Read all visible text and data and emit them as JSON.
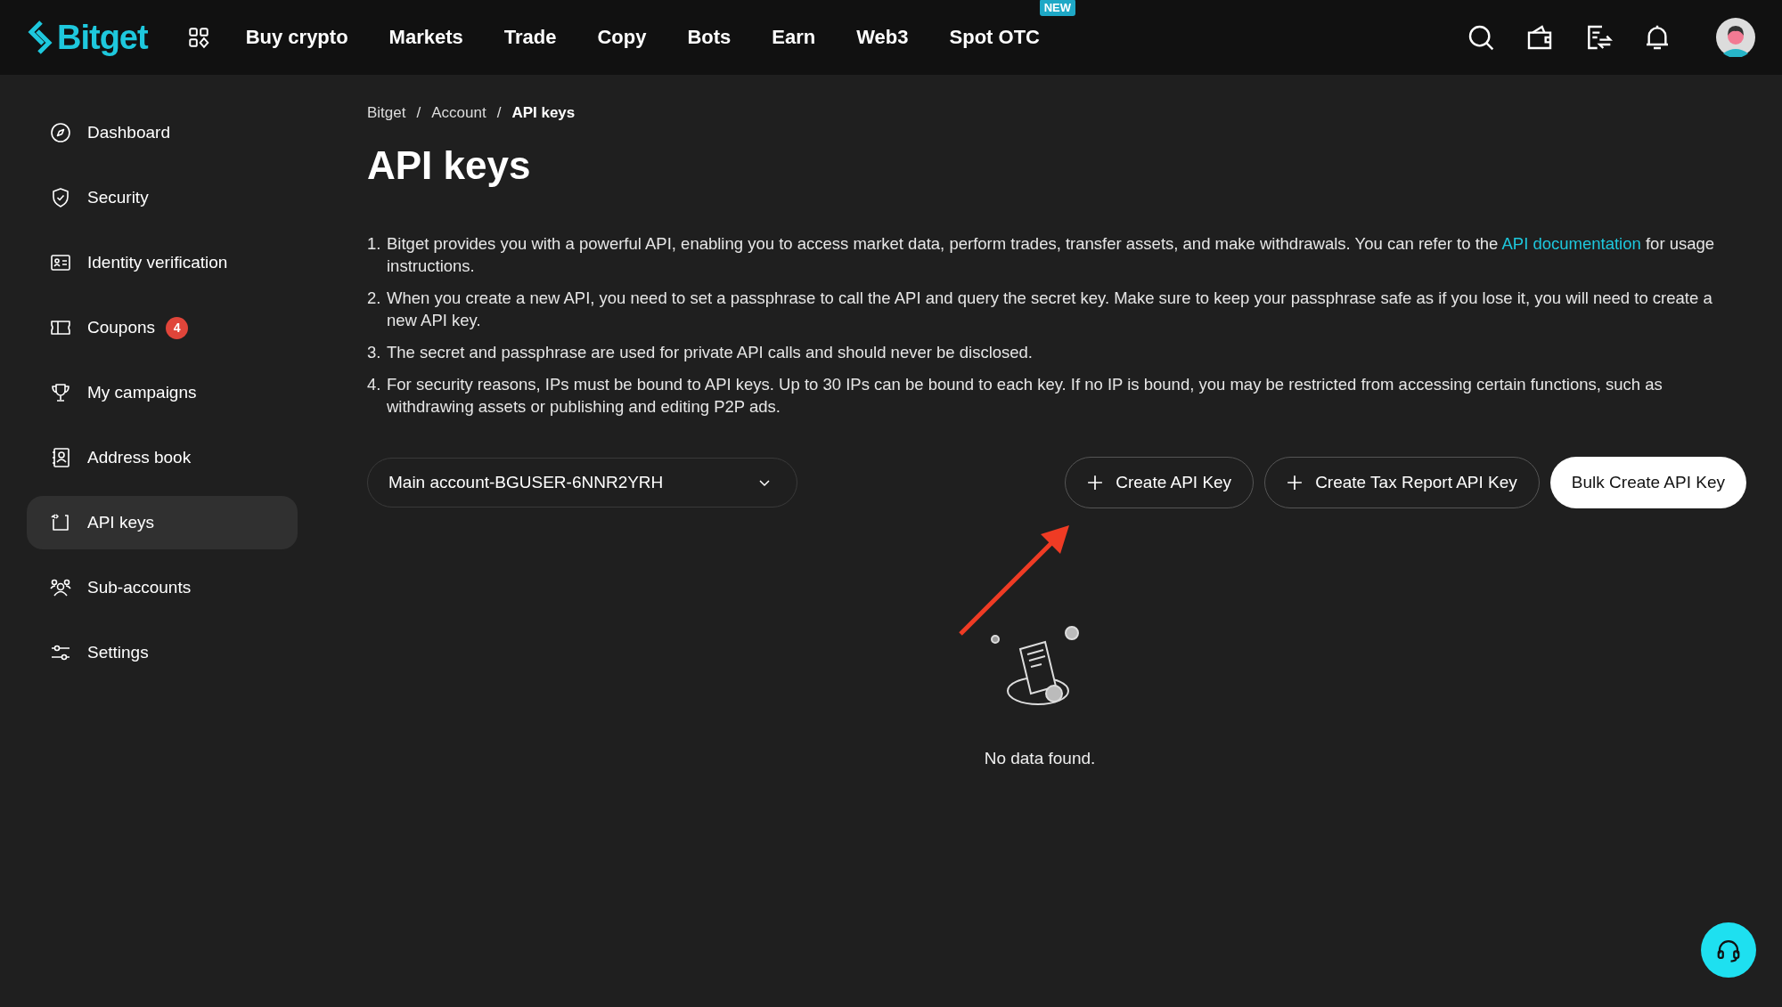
{
  "header": {
    "logo": "Bitget",
    "nav": [
      {
        "label": "Buy crypto"
      },
      {
        "label": "Markets"
      },
      {
        "label": "Trade"
      },
      {
        "label": "Copy"
      },
      {
        "label": "Bots"
      },
      {
        "label": "Earn"
      },
      {
        "label": "Web3"
      },
      {
        "label": "Spot OTC",
        "badge": "NEW"
      }
    ]
  },
  "sidebar": {
    "items": [
      {
        "label": "Dashboard",
        "selected": false
      },
      {
        "label": "Security",
        "selected": false
      },
      {
        "label": "Identity verification",
        "selected": false
      },
      {
        "label": "Coupons",
        "selected": false,
        "badge": "4"
      },
      {
        "label": "My campaigns",
        "selected": false
      },
      {
        "label": "Address book",
        "selected": false
      },
      {
        "label": "API keys",
        "selected": true
      },
      {
        "label": "Sub-accounts",
        "selected": false
      },
      {
        "label": "Settings",
        "selected": false
      }
    ]
  },
  "breadcrumb": [
    {
      "label": "Bitget"
    },
    {
      "label": "Account",
      "separator": "/"
    },
    {
      "label": "API keys",
      "separator": "/"
    }
  ],
  "title": "API keys",
  "instructions": [
    {
      "number": "1.",
      "segments": [
        {
          "kind": "text",
          "text": "Bitget provides you with a powerful API, enabling you to access market data, perform trades, transfer assets, and make withdrawals. You can refer to the "
        },
        {
          "kind": "link",
          "text": "API documentation"
        },
        {
          "kind": "text",
          "text": " for usage instructions."
        }
      ]
    },
    {
      "number": "2.",
      "segments": [
        {
          "kind": "text",
          "text": "When you create a new API, you need to set a passphrase to call the API and query the secret key. Make sure to keep your passphrase safe as if you lose it, you will need to create a new API key."
        }
      ]
    },
    {
      "number": "3.",
      "segments": [
        {
          "kind": "text",
          "text": "The secret and passphrase are used for private API calls and should never be disclosed."
        }
      ]
    },
    {
      "number": "4.",
      "segments": [
        {
          "kind": "text",
          "text": "For security reasons, IPs must be bound to API keys. Up to 30 IPs can be bound to each key. If no IP is bound, you may be restricted from accessing certain functions, such as withdrawing assets or publishing and editing P2P ads."
        }
      ]
    }
  ],
  "account_select": {
    "value": "Main account-BGUSER-6NNR2YRH"
  },
  "buttons": [
    {
      "label": "Create API Key",
      "kind": "outline"
    },
    {
      "label": "Create Tax Report API Key",
      "kind": "outline"
    },
    {
      "label": "Bulk Create API Key",
      "kind": "solid"
    }
  ],
  "empty_state": {
    "message": "No data found."
  }
}
